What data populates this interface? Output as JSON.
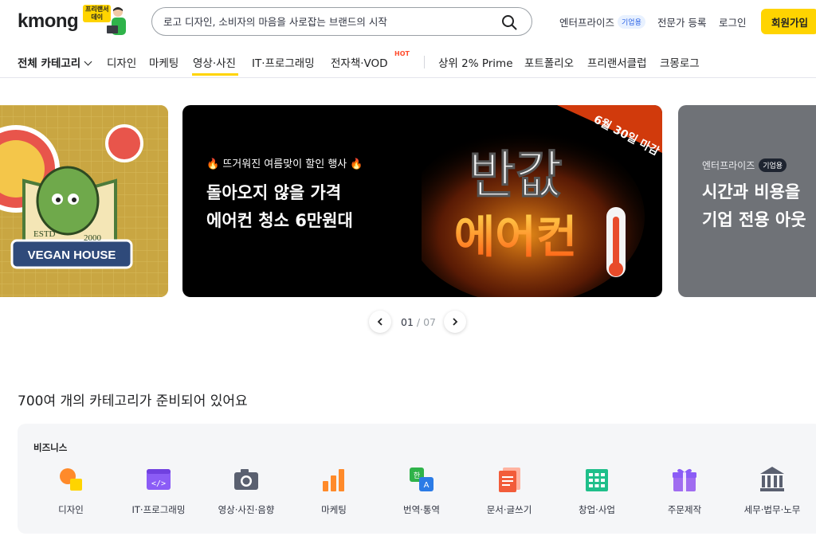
{
  "header": {
    "logo": "kmong",
    "promo_line1": "프리랜서",
    "promo_line2": "데이",
    "search_placeholder": "로고 디자인, 소비자의 마음을 사로잡는 브랜드의 시작",
    "enterprise_label": "엔터프라이즈",
    "enterprise_badge": "기업용",
    "expert_register": "전문가 등록",
    "login": "로그인",
    "signup": "회원가입"
  },
  "category_nav": {
    "all": "전체 카테고리",
    "items": [
      "디자인",
      "마케팅",
      "영상·사진",
      "IT·프로그래밍",
      "전자책·VOD",
      "상위 2% Prime",
      "포트폴리오",
      "프리랜서클럽",
      "크몽로그"
    ],
    "active": "영상·사진",
    "hot_badge": "HOT"
  },
  "banners": {
    "left_sticker_main": "VEGAN HOUSE",
    "left_sticker_estd": "ESTD",
    "left_sticker_year": "2000",
    "main_subtitle": "🔥 뜨거워진 여름맞이 할인 행사 🔥",
    "main_title_line1": "돌아오지 않을 가격",
    "main_title_line2": "에어컨 청소 6만원대",
    "main_graphic_top": "반값",
    "main_graphic_bottom": "에어컨",
    "main_graphic_ribbon": "6월 30일 마감",
    "right_subtitle": "엔터프라이즈",
    "right_badge": "기업용",
    "right_title_line1": "시간과 비용을",
    "right_title_line2": "기업 전용 아웃"
  },
  "pager": {
    "current": "01",
    "separator": " / ",
    "total": "07"
  },
  "categories_section": {
    "title": "700여 개의 카테고리가 준비되어 있어요",
    "group_label": "비즈니스",
    "items": [
      {
        "label": "디자인",
        "icon": "design-icon"
      },
      {
        "label": "IT·프로그래밍",
        "icon": "code-icon"
      },
      {
        "label": "영상·사진·음향",
        "icon": "camera-icon"
      },
      {
        "label": "마케팅",
        "icon": "bar-chart-icon"
      },
      {
        "label": "번역·통역",
        "icon": "translate-icon"
      },
      {
        "label": "문서·글쓰기",
        "icon": "document-icon"
      },
      {
        "label": "창업·사업",
        "icon": "building-icon"
      },
      {
        "label": "주문제작",
        "icon": "gift-icon"
      },
      {
        "label": "세무·법무·노무",
        "icon": "bank-icon"
      }
    ]
  },
  "colors": {
    "brand_yellow": "#ffd400",
    "text_dark": "#212224",
    "hot_red": "#ff4d2e"
  }
}
